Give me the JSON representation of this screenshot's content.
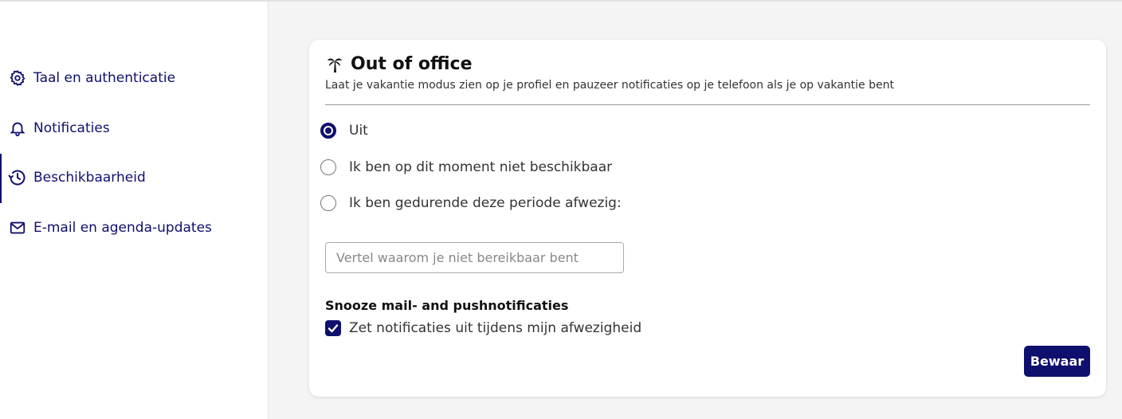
{
  "sidebar": {
    "items": [
      {
        "label": "Taal en authenticatie",
        "icon": "gear-icon"
      },
      {
        "label": "Notificaties",
        "icon": "bell-icon"
      },
      {
        "label": "Beschikbaarheid",
        "icon": "history-icon",
        "active": true
      },
      {
        "label": "E-mail en agenda-updates",
        "icon": "mail-icon"
      }
    ]
  },
  "card": {
    "icon": "palm-tree-icon",
    "title": "Out of office",
    "subtitle": "Laat je vakantie modus zien op je profiel en pauzeer notificaties op je telefoon als je op vakantie bent",
    "options": [
      {
        "label": "Uit",
        "selected": true
      },
      {
        "label": "Ik ben op dit moment niet beschikbaar",
        "selected": false
      },
      {
        "label": "Ik ben gedurende deze periode afwezig:",
        "selected": false
      }
    ],
    "reason_input": {
      "value": "",
      "placeholder": "Vertel waarom je niet bereikbaar bent"
    },
    "snooze_label": "Snooze mail- and pushnotificaties",
    "snooze_checkbox": {
      "label": "Zet notificaties uit tijdens mijn afwezigheid",
      "checked": true
    },
    "save_label": "Bewaar"
  },
  "colors": {
    "accent": "#0f0f6e",
    "background": "#f4f4f4"
  }
}
